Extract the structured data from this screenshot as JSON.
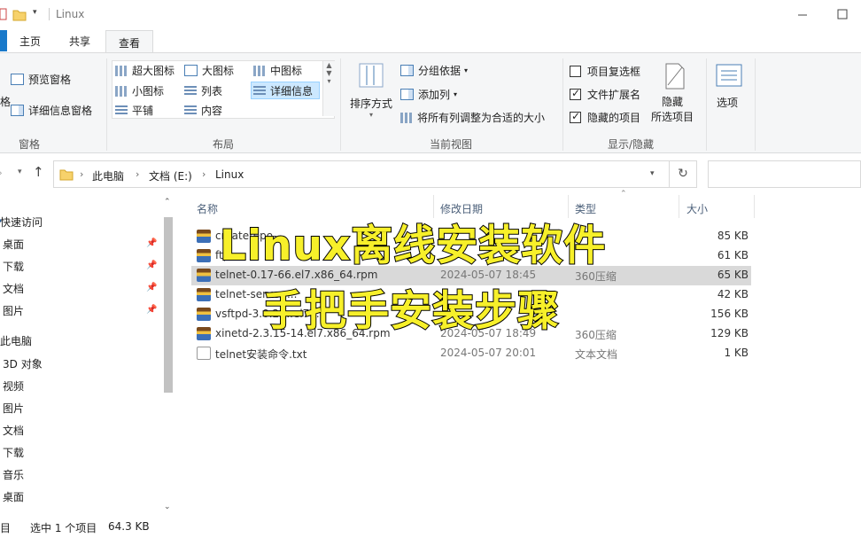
{
  "window": {
    "title": "Linux"
  },
  "ribbon": {
    "tabs": [
      "主页",
      "共享",
      "查看"
    ],
    "active_tab": "查看",
    "pane_group": {
      "preview": "预览窗格",
      "details_pane": "详细信息窗格",
      "label": "窗格",
      "nav_partial": "格"
    },
    "layout_group": {
      "items": [
        "超大图标",
        "大图标",
        "中图标",
        "小图标",
        "列表",
        "详细信息",
        "平铺",
        "内容"
      ],
      "selected": "详细信息",
      "label": "布局"
    },
    "current_view_group": {
      "sort": "排序方式",
      "group_by": "分组依据",
      "add_column": "添加列",
      "fit_columns": "将所有列调整为合适的大小",
      "label": "当前视图"
    },
    "show_hide_group": {
      "checkboxes": [
        {
          "label": "项目复选框",
          "checked": false
        },
        {
          "label": "文件扩展名",
          "checked": true
        },
        {
          "label": "隐藏的项目",
          "checked": true
        }
      ],
      "hide_selected": [
        "隐藏",
        "所选项目"
      ],
      "label": "显示/隐藏"
    },
    "options": "选项"
  },
  "address": {
    "crumbs": [
      "此电脑",
      "文档 (E:)",
      "Linux"
    ]
  },
  "nav_pane": {
    "quick_access": "快速访问",
    "quick_items": [
      "桌面",
      "下载",
      "文档",
      "图片"
    ],
    "this_pc": "此电脑",
    "pc_items": [
      "3D 对象",
      "视频",
      "图片",
      "文档",
      "下载",
      "音乐",
      "桌面"
    ]
  },
  "columns": [
    "名称",
    "修改日期",
    "类型",
    "大小"
  ],
  "files": [
    {
      "name": "createrepo-...",
      "date": "",
      "type": "",
      "size": "85 KB",
      "icon": "rpm"
    },
    {
      "name": "ftp-...",
      "date": "",
      "type": "",
      "size": "61 KB",
      "icon": "rpm"
    },
    {
      "name": "telnet-0.17-66.el7.x86_64.rpm",
      "date": "2024-05-07 18:45",
      "type": "360压缩",
      "size": "65 KB",
      "icon": "rpm",
      "selected": true
    },
    {
      "name": "telnet-server-...",
      "date": "",
      "type": "",
      "size": "42 KB",
      "icon": "rpm"
    },
    {
      "name": "vsftpd-3.0.2-...el7...",
      "date": "",
      "type": "",
      "size": "156 KB",
      "icon": "rpm"
    },
    {
      "name": "xinetd-2.3.15-14.el7.x86_64.rpm",
      "date": "2024-05-07 18:49",
      "type": "360压缩",
      "size": "129 KB",
      "icon": "rpm"
    },
    {
      "name": "telnet安装命令.txt",
      "date": "2024-05-07 20:01",
      "type": "文本文档",
      "size": "1 KB",
      "icon": "txt"
    }
  ],
  "overlay": {
    "line1": "Linux离线安装软件",
    "line2": "手把手安装步骤"
  },
  "status": {
    "count_partial": "目",
    "selected": "选中 1 个项目",
    "size": "64.3 KB"
  },
  "colors": {
    "accent": "#1979ca",
    "overlay_text": "#f7f02a",
    "selection": "#cce8ff"
  }
}
